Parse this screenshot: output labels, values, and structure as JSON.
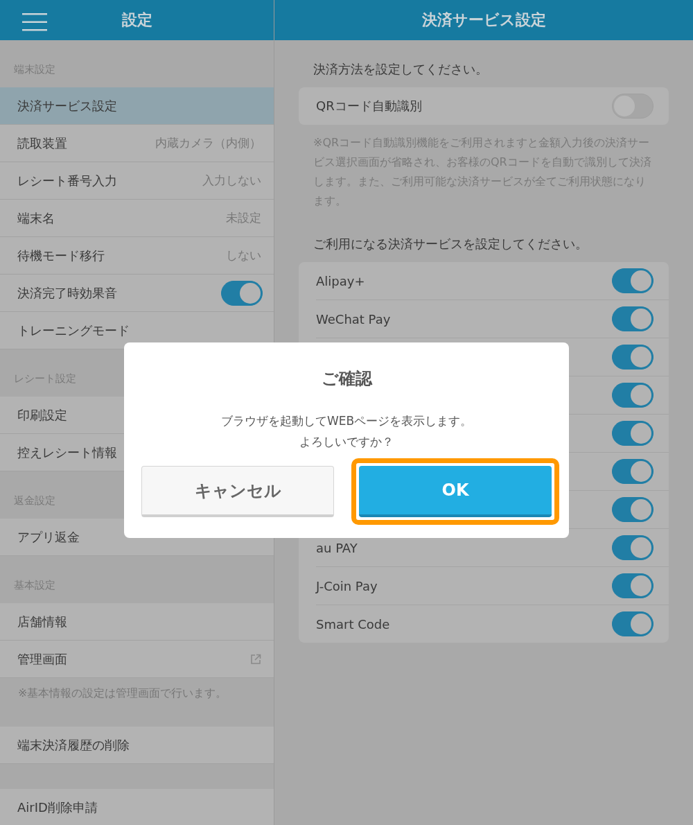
{
  "sidebar": {
    "title": "設定",
    "sections": [
      {
        "title": "端末設定",
        "items": [
          {
            "kind": "plain",
            "label": "決済サービス設定",
            "selected": true
          },
          {
            "kind": "value",
            "label": "読取装置",
            "value": "内蔵カメラ（内側）",
            "selected": false
          },
          {
            "kind": "value",
            "label": "レシート番号入力",
            "value": "入力しない",
            "selected": false
          },
          {
            "kind": "value",
            "label": "端末名",
            "value": "未設定",
            "selected": false
          },
          {
            "kind": "value",
            "label": "待機モード移行",
            "value": "しない",
            "selected": false
          },
          {
            "kind": "toggle",
            "label": "決済完了時効果音",
            "on": true,
            "selected": false
          },
          {
            "kind": "plain",
            "label": "トレーニングモード",
            "selected": false
          }
        ]
      },
      {
        "title": "レシート設定",
        "items": [
          {
            "kind": "plain",
            "label": "印刷設定",
            "selected": false
          },
          {
            "kind": "plain",
            "label": "控えレシート情報",
            "selected": false
          }
        ]
      },
      {
        "title": "返金設定",
        "items": [
          {
            "kind": "plain",
            "label": "アプリ返金",
            "selected": false
          }
        ]
      },
      {
        "title": "基本設定",
        "items": [
          {
            "kind": "plain",
            "label": "店舗情報",
            "selected": false
          },
          {
            "kind": "link",
            "label": "管理画面",
            "selected": false
          }
        ],
        "note": "※基本情報の設定は管理画面で行います。"
      },
      {
        "items": [
          {
            "kind": "plain",
            "label": "端末決済履歴の削除",
            "selected": false
          }
        ]
      },
      {
        "items": [
          {
            "kind": "plain",
            "label": "AirID削除申請",
            "selected": false
          }
        ]
      }
    ]
  },
  "main": {
    "title": "決済サービス設定",
    "method_heading": "決済方法を設定してください。",
    "auto_detect": {
      "label": "QRコード自動識別",
      "on": false
    },
    "note": "※QRコード自動識別機能をご利用されますと金額入力後の決済サービス選択画面が省略され、お客様のQRコードを自動で識別して決済します。また、ご利用可能な決済サービスが全てご利用状態になります。",
    "services_heading": "ご利用になる決済サービスを設定してください。",
    "services": [
      {
        "label": "Alipay+",
        "on": true
      },
      {
        "label": "WeChat Pay",
        "on": true
      },
      {
        "on": true
      },
      {
        "on": true
      },
      {
        "on": true
      },
      {
        "on": true
      },
      {
        "on": true
      },
      {
        "label": "au PAY",
        "on": true
      },
      {
        "label": "J-Coin Pay",
        "on": true
      },
      {
        "label": "Smart Code",
        "on": true
      }
    ]
  },
  "dialog": {
    "title": "ご確認",
    "message": [
      "ブラウザを起動してWEBページを表示します。",
      "よろしいですか？"
    ],
    "buttons": [
      {
        "label": "キャンセル",
        "kind": "secondary",
        "highlighted": false
      },
      {
        "label": "OK",
        "kind": "primary",
        "highlighted": true
      }
    ]
  }
}
